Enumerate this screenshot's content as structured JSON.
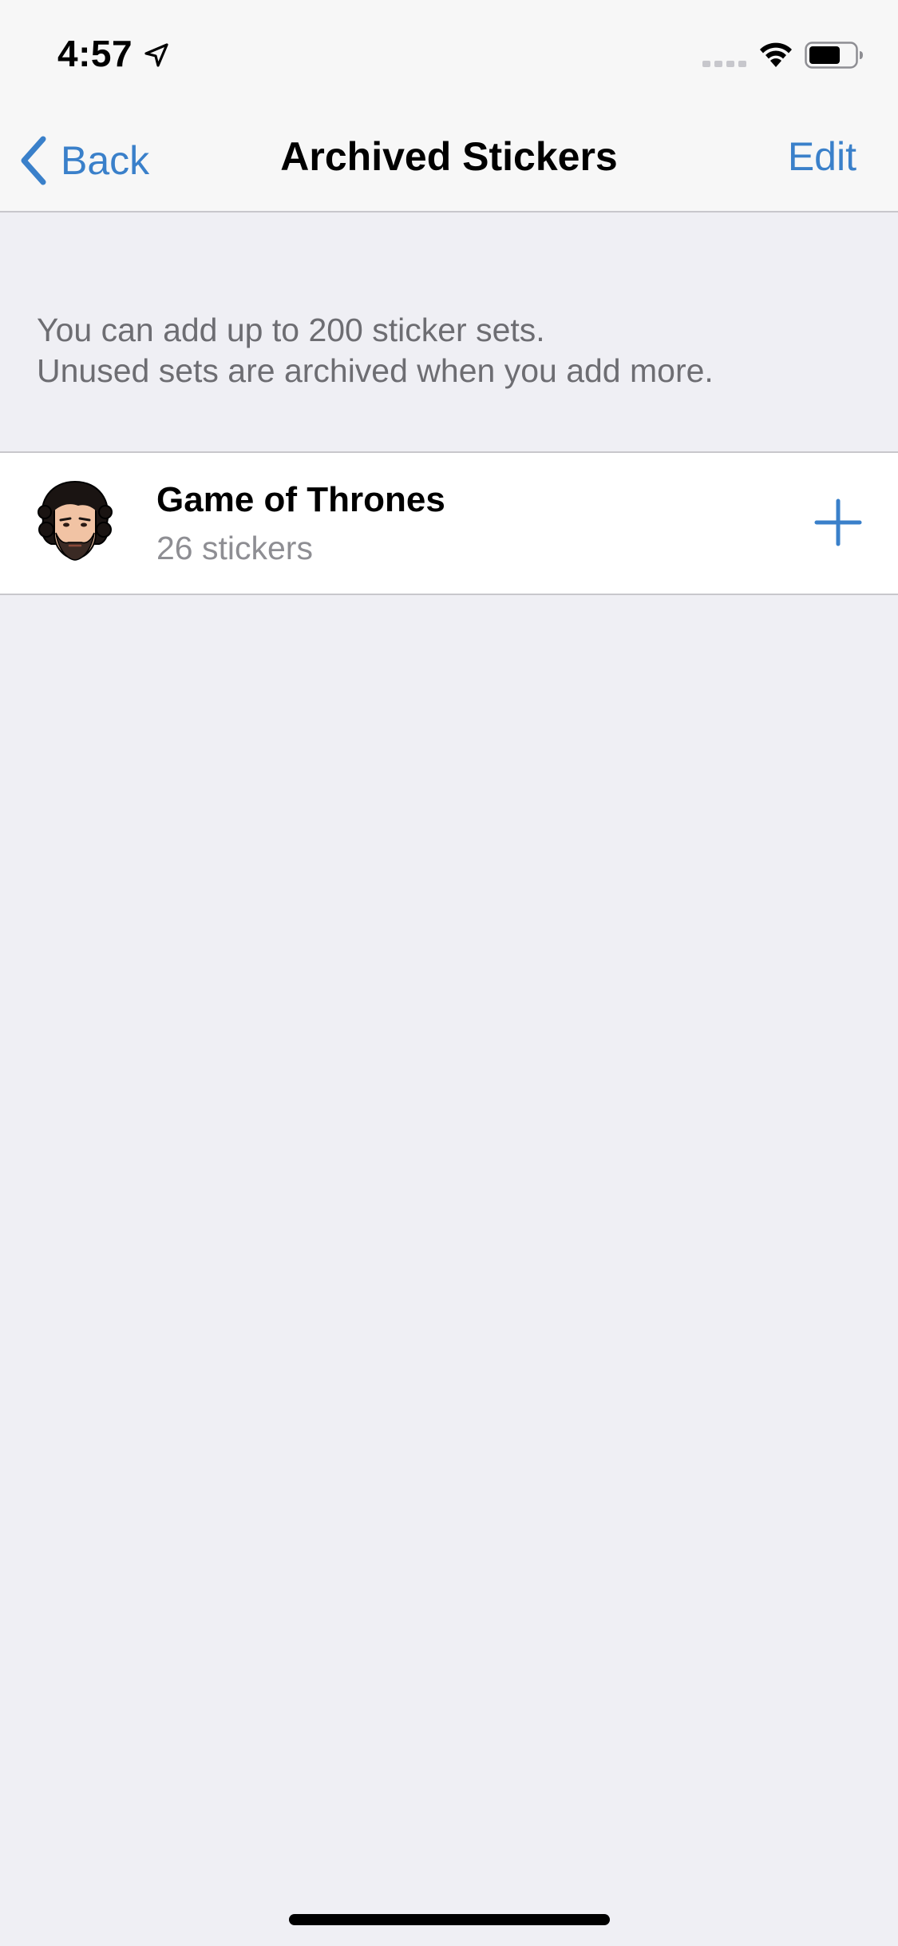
{
  "status_bar": {
    "time": "4:57",
    "icons": [
      "location-arrow-icon",
      "cellular-signal-icon",
      "wifi-icon",
      "battery-icon"
    ]
  },
  "nav": {
    "back_label": "Back",
    "title": "Archived Stickers",
    "edit_label": "Edit"
  },
  "info": {
    "line1": "You can add up to 200 sticker sets.",
    "line2": "Unused sets are archived when you add more."
  },
  "sticker_sets": [
    {
      "name": "Game of Thrones",
      "count": "26 stickers",
      "action_icon": "plus-icon"
    }
  ],
  "colors": {
    "accent": "#3a80ca",
    "background": "#efeff4",
    "bar_background": "#f7f7f7",
    "separator": "#c8c7cc",
    "secondary_text": "#8e8e93"
  }
}
